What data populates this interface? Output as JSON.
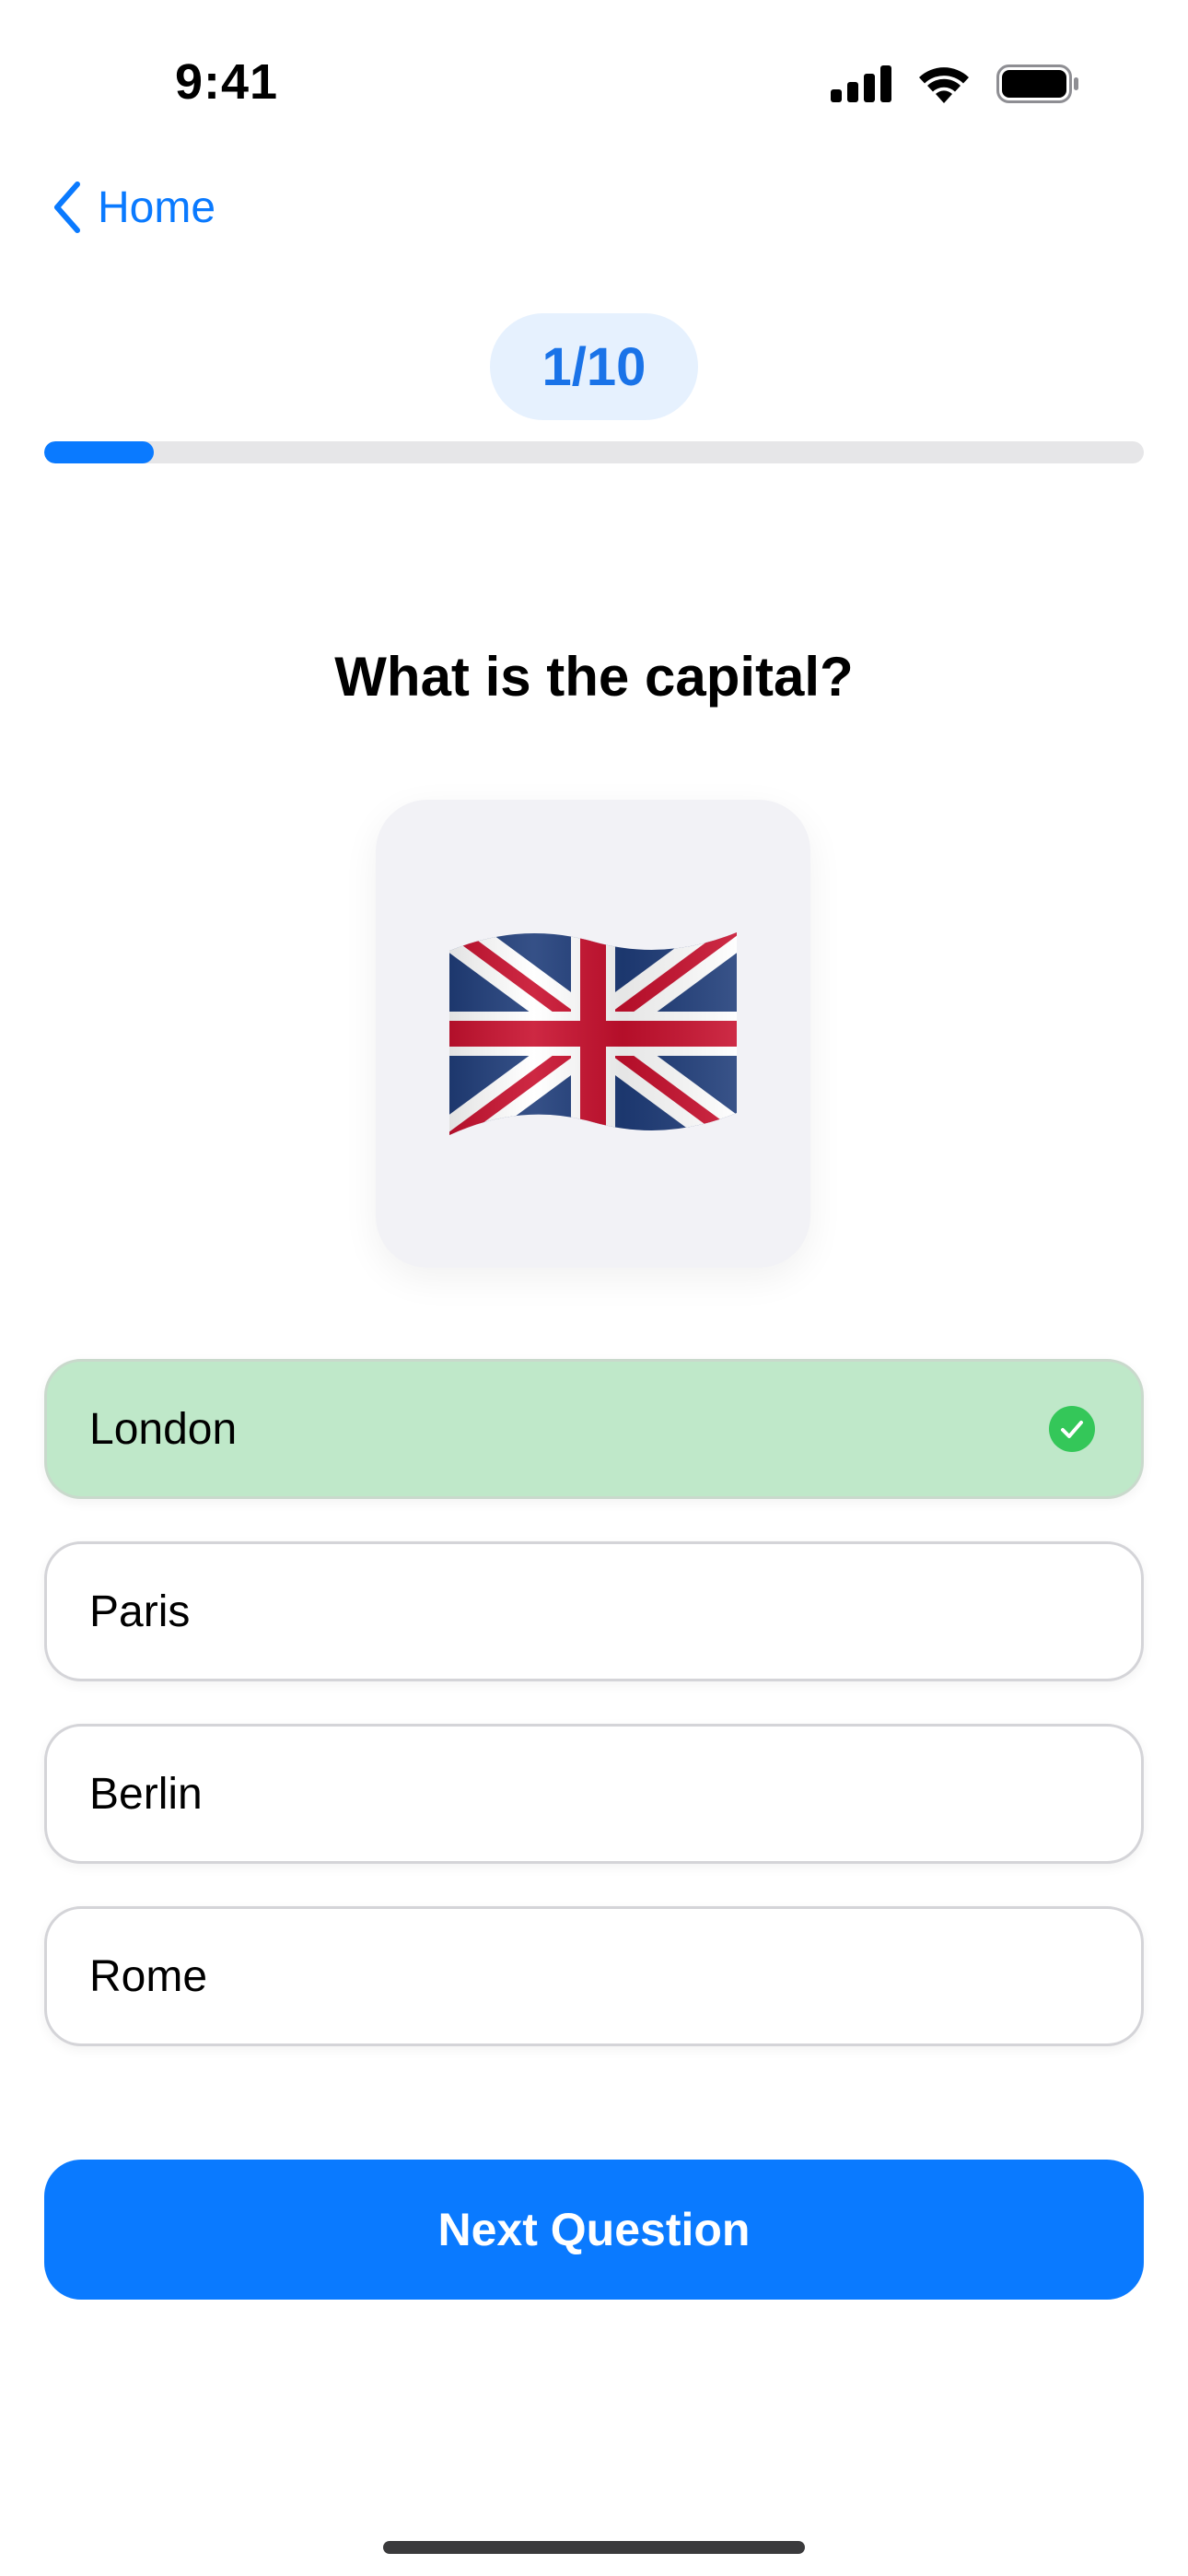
{
  "status_bar": {
    "time": "9:41",
    "icons": [
      "signal-icon",
      "wifi-icon",
      "battery-icon"
    ]
  },
  "nav": {
    "back_label": "Home",
    "back_icon": "chevron-left-icon"
  },
  "quiz": {
    "counter": "1/10",
    "progress_fraction": 0.1,
    "question": "What is the capital?",
    "flag_icon": "uk-flag-icon",
    "options": [
      {
        "label": "London",
        "state": "correct"
      },
      {
        "label": "Paris",
        "state": "default"
      },
      {
        "label": "Berlin",
        "state": "default"
      },
      {
        "label": "Rome",
        "state": "default"
      }
    ],
    "next_label": "Next Question"
  },
  "colors": {
    "accent": "#0a7aff",
    "correct_bg": "#bfe8c9",
    "check_green": "#34c759",
    "pill_bg": "#e6f1fe"
  }
}
